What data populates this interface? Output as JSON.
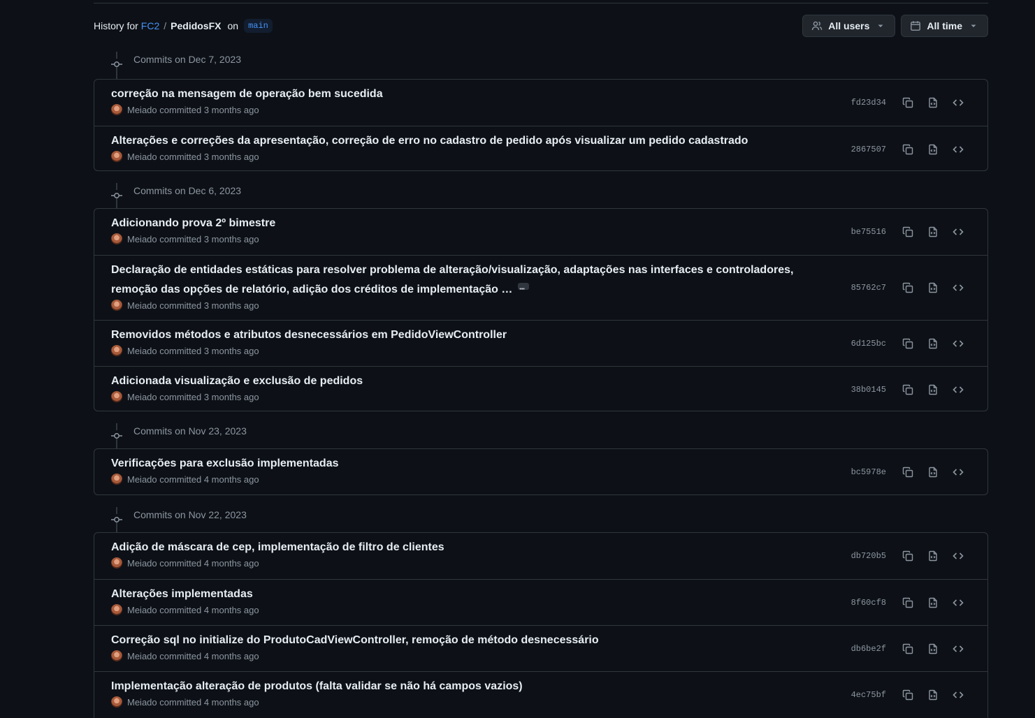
{
  "header": {
    "history_for": "History for",
    "owner": "FC2",
    "separator": "/",
    "repo": "PedidosFX",
    "on": "on",
    "branch": "main"
  },
  "filters": {
    "users": "All users",
    "time": "All time"
  },
  "groups": [
    {
      "label": "Commits on Dec 7, 2023",
      "commits": [
        {
          "message": "correção na mensagem de operação bem sucedida",
          "author": "Meiado",
          "time": "committed 3 months ago",
          "sha": "fd23d34"
        },
        {
          "message": "Alterações e correções da apresentação, correção de erro no cadastro de pedido após visualizar um pedido cadastrado",
          "author": "Meiado",
          "time": "committed 3 months ago",
          "sha": "2867507"
        }
      ]
    },
    {
      "label": "Commits on Dec 6, 2023",
      "commits": [
        {
          "message": "Adicionando prova 2º bimestre",
          "author": "Meiado",
          "time": "committed 3 months ago",
          "sha": "be75516"
        },
        {
          "message": "Declaração de entidades estáticas para resolver problema de alteração/visualização, adaptações nas interfaces e controladores, remoção das opções de relatório, adição dos créditos de implementação …",
          "author": "Meiado",
          "time": "committed 3 months ago",
          "sha": "85762c7"
        },
        {
          "message": "Removidos métodos e atributos desnecessários em PedidoViewController",
          "author": "Meiado",
          "time": "committed 3 months ago",
          "sha": "6d125bc"
        },
        {
          "message": "Adicionada visualização e exclusão de pedidos",
          "author": "Meiado",
          "time": "committed 3 months ago",
          "sha": "38b0145"
        }
      ]
    },
    {
      "label": "Commits on Nov 23, 2023",
      "commits": [
        {
          "message": "Verificações para exclusão implementadas",
          "author": "Meiado",
          "time": "committed 4 months ago",
          "sha": "bc5978e"
        }
      ]
    },
    {
      "label": "Commits on Nov 22, 2023",
      "commits": [
        {
          "message": "Adição de máscara de cep, implementação de filtro de clientes",
          "author": "Meiado",
          "time": "committed 4 months ago",
          "sha": "db720b5"
        },
        {
          "message": "Alterações implementadas",
          "author": "Meiado",
          "time": "committed 4 months ago",
          "sha": "8f60cf8"
        },
        {
          "message": "Correção sql no initialize do ProdutoCadViewController, remoção de método desnecessário",
          "author": "Meiado",
          "time": "committed 4 months ago",
          "sha": "db6be2f"
        },
        {
          "message": "Implementação alteração de produtos (falta validar se não há campos vazios)",
          "author": "Meiado",
          "time": "committed 4 months ago",
          "sha": "4ec75bf"
        }
      ]
    }
  ]
}
